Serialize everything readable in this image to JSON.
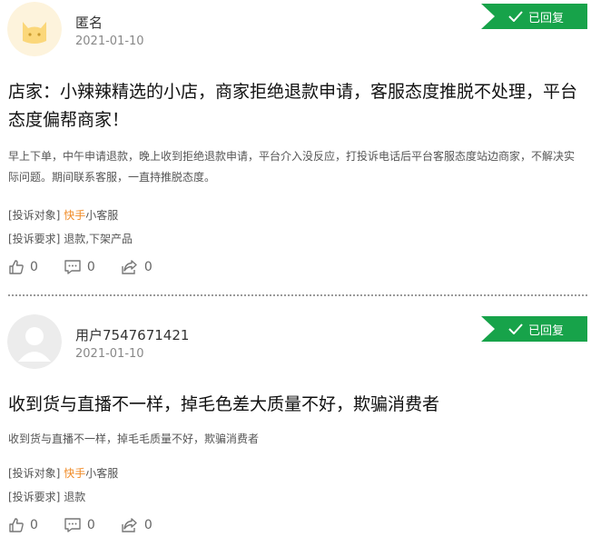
{
  "complaints": [
    {
      "user": "匿名",
      "date": "2021-01-10",
      "status": "已回复",
      "title": "店家：小辣辣精选的小店，商家拒绝退款申请，客服态度推脱不处理，平台态度偏帮商家！",
      "content": "早上下单，中午申请退款，晚上收到拒绝退款申请，平台介入没反应，打投诉电话后平台客服态度站边商家，不解决实际问题。期间联系客服，一直持推脱态度。",
      "target_label": "[投诉对象]",
      "target_highlight": "快手",
      "target_rest": "小客服",
      "request_label": "[投诉要求]",
      "request_value": "退款,下架产品",
      "likes": "0",
      "comments": "0",
      "shares": "0"
    },
    {
      "user": "用户7547671421",
      "date": "2021-01-10",
      "status": "已回复",
      "title": "收到货与直播不一样，掉毛色差大质量不好，欺骗消费者",
      "content": "收到货与直播不一样，掉毛毛质量不好，欺骗消费者",
      "target_label": "[投诉对象]",
      "target_highlight": "快手",
      "target_rest": "小客服",
      "request_label": "[投诉要求]",
      "request_value": "退款",
      "likes": "0",
      "comments": "0",
      "shares": "0"
    }
  ],
  "icons": {
    "like": "thumbs-up-icon",
    "comment": "comment-icon",
    "share": "share-icon",
    "check": "check-icon"
  },
  "colors": {
    "replied_badge": "#17a34a",
    "highlight": "#f08a24"
  }
}
